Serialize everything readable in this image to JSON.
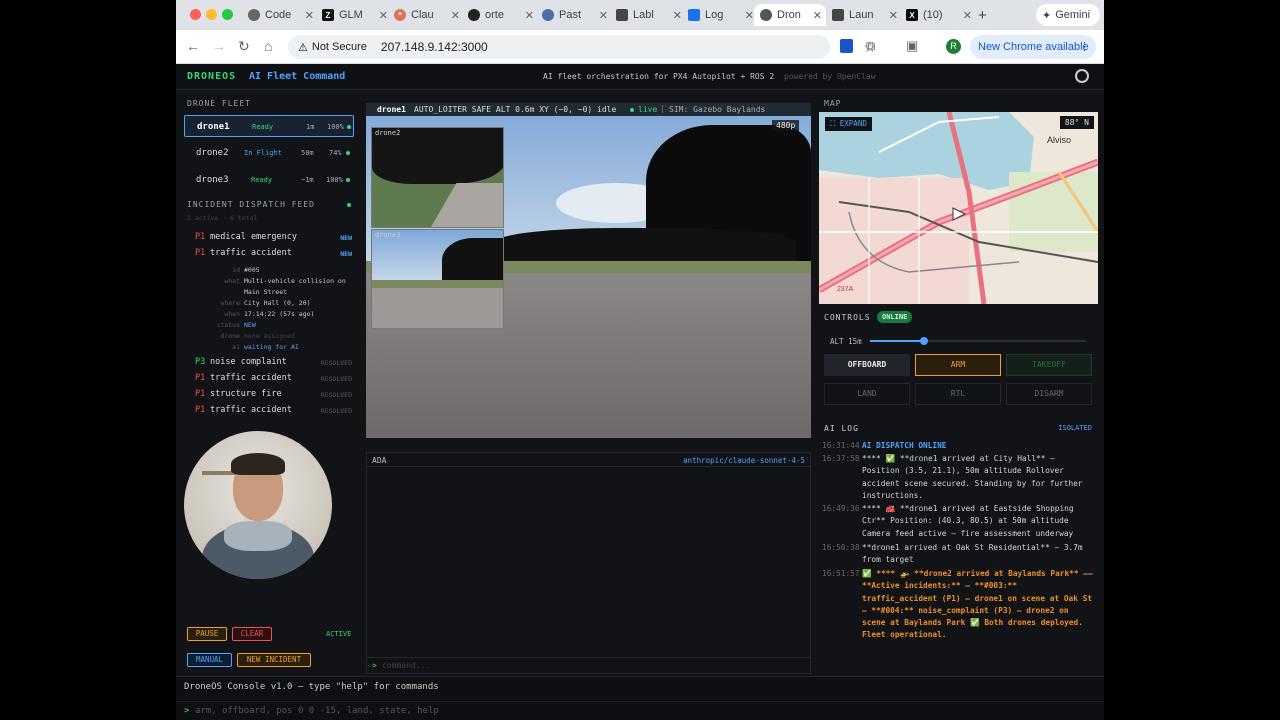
{
  "browser": {
    "tabs": [
      {
        "label": "Code",
        "favicon": "C"
      },
      {
        "label": "GLM",
        "favicon": "Z"
      },
      {
        "label": "Clau",
        "favicon": "*"
      },
      {
        "label": "orte",
        "favicon": "gh"
      },
      {
        "label": "Past",
        "favicon": "o"
      },
      {
        "label": "Labl",
        "favicon": "L"
      },
      {
        "label": "Log",
        "favicon": "V"
      },
      {
        "label": "Dron",
        "favicon": "o"
      },
      {
        "label": "Laun",
        "favicon": "L"
      },
      {
        "label": "(10)",
        "favicon": "X"
      }
    ],
    "gemini_label": "Gemini",
    "security_label": "Not Secure",
    "url": "207.148.9.142:3000",
    "profile_initial": "R",
    "update_label": "New Chrome available"
  },
  "header": {
    "brand": "DRONEOS",
    "subtitle": "AI Fleet Command",
    "tagline": "AI fleet orchestration for PX4 Autopilot + ROS 2",
    "powered": "powered by OpenClaw"
  },
  "fleet": {
    "title": "DRONE FLEET",
    "drones": [
      {
        "name": "drone1",
        "status": "Ready",
        "time": "1m",
        "battery": "100%"
      },
      {
        "name": "drone2",
        "status": "In Flight",
        "time": "50m",
        "battery": "74%"
      },
      {
        "name": "drone3",
        "status": "Ready",
        "time": "~1m",
        "battery": "100%"
      }
    ]
  },
  "incidents": {
    "title": "INCIDENT DISPATCH FEED",
    "summary": "2 active · 6 total",
    "items": [
      {
        "priority": "P1",
        "name": "medical emergency",
        "state": "NEW"
      },
      {
        "priority": "P1",
        "name": "traffic accident",
        "state": "NEW"
      },
      {
        "priority": "P3",
        "name": "noise complaint",
        "state": "RESOLVED"
      },
      {
        "priority": "P1",
        "name": "traffic accident",
        "state": "RESOLVED"
      },
      {
        "priority": "P1",
        "name": "structure fire",
        "state": "RESOLVED"
      },
      {
        "priority": "P1",
        "name": "traffic accident",
        "state": "RESOLVED"
      }
    ],
    "detail": {
      "id_k": "id",
      "id_v": "#005",
      "what_k": "what",
      "what_v1": "Multi-vehicle collision on",
      "what_v2": "Main Street",
      "where_k": "where",
      "where_v": "City Hall (0, 20)",
      "when_k": "when",
      "when_v": "17:14:22 (57s ago)",
      "status_k": "status",
      "status_v": "NEW",
      "drone_k": "drone",
      "drone_v": "none assigned",
      "ai_k": "ai",
      "ai_v": "waiting for AI"
    }
  },
  "left_controls": {
    "pause": "PAUSE",
    "clear": "CLEAR",
    "active": "ACTIVE",
    "manual": "MANUAL",
    "new_incident": "NEW INCIDENT"
  },
  "video": {
    "drone": "drone1",
    "telemetry": "AUTO_LOITER SAFE ALT 0.6m XY (−0, −0) idle",
    "live": "live",
    "sim": "SIM: Gazebo Baylands",
    "resolution": "480p",
    "inset1": "drone2",
    "inset2": "drone3"
  },
  "chat": {
    "agent": "ADA",
    "model": "anthropic/claude-sonnet-4-5",
    "prompt": ">",
    "placeholder": "command..."
  },
  "map": {
    "title": "MAP",
    "expand": "EXPAND",
    "heading": "88° N",
    "place": "Alviso",
    "road": "237A"
  },
  "controls": {
    "title": "CONTROLS",
    "status": "ONLINE",
    "altitude_label": "ALT 15m",
    "altitude_fraction": 0.25,
    "buttons": [
      "OFFBOARD",
      "ARM",
      "TAKEOFF",
      "LAND",
      "RTL",
      "DISARM"
    ]
  },
  "ailog": {
    "title": "AI LOG",
    "mode": "ISOLATED",
    "entries": [
      {
        "time": "16:31:44",
        "text": "AI DISPATCH ONLINE"
      },
      {
        "time": "16:37:58",
        "text": "**** ✅ **drone1 arrived at City Hall** — Position (3.5, 21.1), 50m altitude Rollover accident scene secured. Standing by for further instructions."
      },
      {
        "time": "16:49:36",
        "text": "**** 🚒 **drone1 arrived at Eastside Shopping Ctr** Position: (40.3, 80.5) at 50m altitude Camera feed active — fire assessment underway"
      },
      {
        "time": "16:50:38",
        "text": "**drone1 arrived at Oak St Residential** — 3.7m from target"
      },
      {
        "time": "16:51:57",
        "text": "✅ **** 🚁 **drone2 arrived at Baylands Park** —— **Active incidents:** — **#003:** traffic_accident (P1) — drone1 on scene at Oak St — **#004:** noise_complaint (P3) — drone2 on scene at Baylands Park ✅ Both drones deployed. Fleet operational."
      }
    ]
  },
  "console": {
    "banner": "DroneOS Console v1.0 — type \"help\" for commands",
    "prompt": ">",
    "hint": "arm, offboard, pos 0 0 -15, land, state, help"
  },
  "colors": {
    "accent": "#4ea3ff",
    "ok": "#37d67a",
    "warn": "#f0a030",
    "danger": "#f05050"
  }
}
